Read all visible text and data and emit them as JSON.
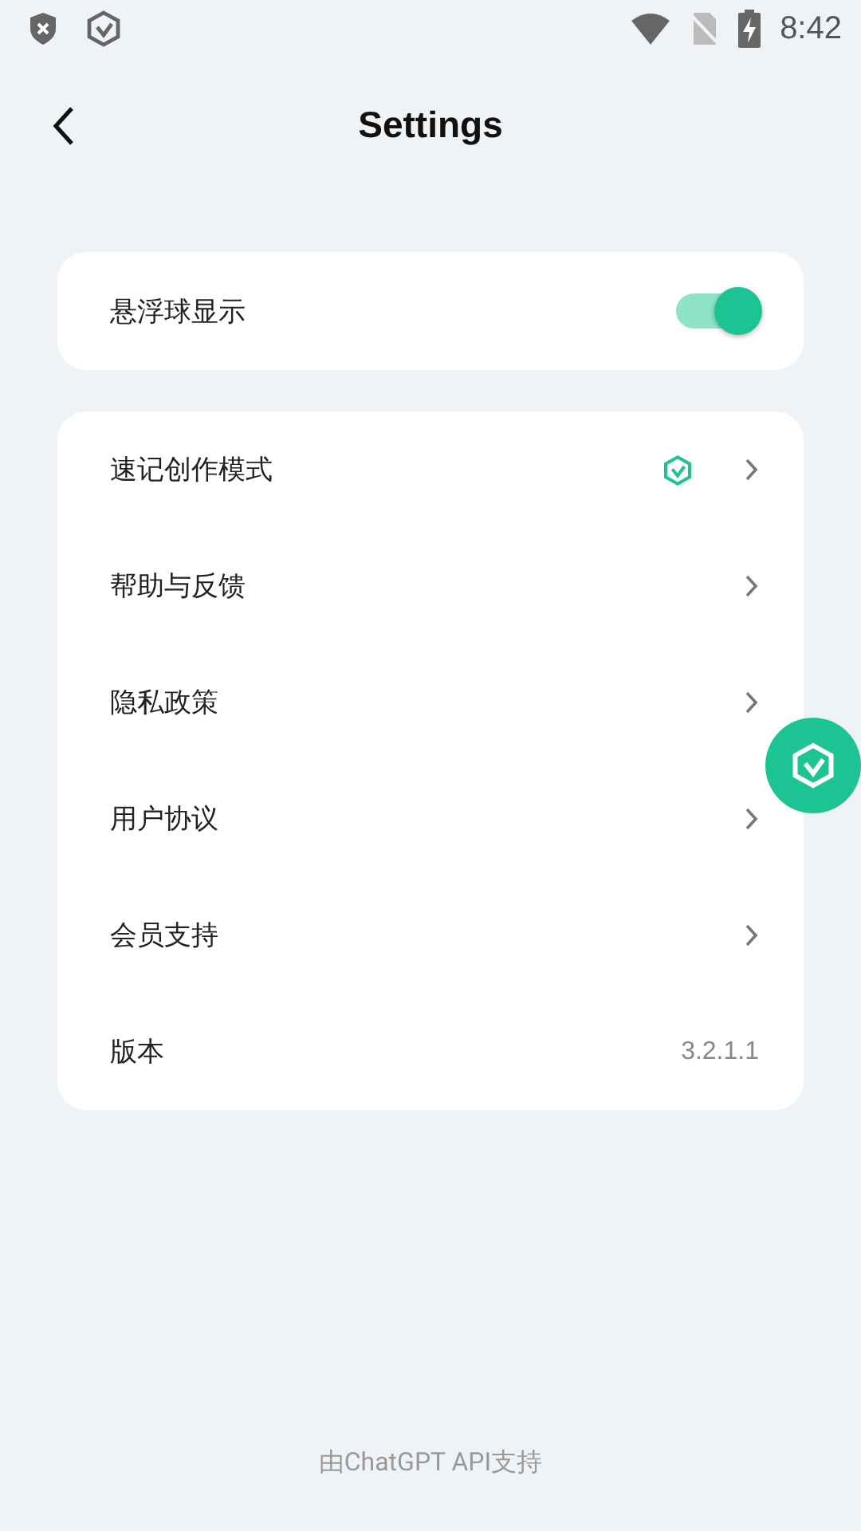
{
  "status_bar": {
    "time": "8:42"
  },
  "header": {
    "title": "Settings"
  },
  "floating_ball": {
    "label": "悬浮球显示",
    "on": true
  },
  "menu": [
    {
      "kind": "link",
      "label": "速记创作模式",
      "badge": true
    },
    {
      "kind": "link",
      "label": "帮助与反馈",
      "badge": false
    },
    {
      "kind": "link",
      "label": "隐私政策",
      "badge": false
    },
    {
      "kind": "link",
      "label": "用户协议",
      "badge": false
    },
    {
      "kind": "link",
      "label": "会员支持",
      "badge": false
    },
    {
      "kind": "value",
      "label": "版本",
      "value": "3.2.1.1"
    }
  ],
  "footer": "由ChatGPT API支持"
}
